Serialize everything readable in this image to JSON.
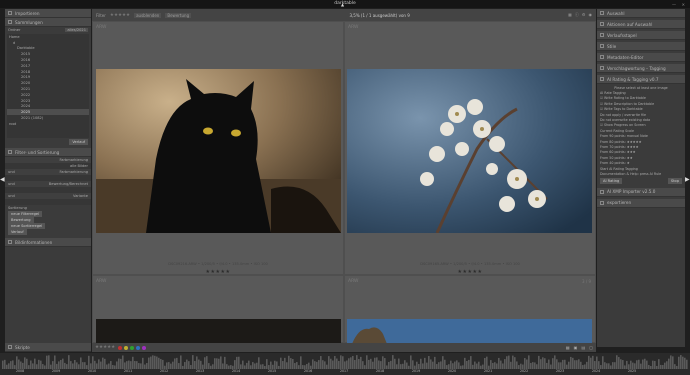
{
  "window": {
    "title": "darktable"
  },
  "left_panel": {
    "modules": {
      "import": "Importieren",
      "collections": "Sammlungen",
      "filters": "Filter- und Sortierung",
      "image_info": "Bildinformationen"
    },
    "collection_rule": {
      "label": "Ordner",
      "value": "alles/2021"
    },
    "tree": [
      "Home",
      "d",
      "Darktable",
      "2015",
      "2016",
      "2017",
      "2018",
      "2019",
      "2020",
      "2021",
      "2022",
      "2023",
      "2024",
      "2025",
      "2021 (1082)",
      "root"
    ],
    "tree_selected_index": 13,
    "history_button": "Verlauf",
    "filter_rows": [
      {
        "label": "",
        "value": "Farbmarkierung"
      },
      {
        "label": "",
        "value": "alle Bilder"
      },
      {
        "label": "und",
        "value": "Farbmarkierung"
      },
      {
        "label": "",
        "value": ""
      },
      {
        "label": "und",
        "value": "Bewertung/Berechnet"
      },
      {
        "label": "",
        "value": ""
      },
      {
        "label": "und",
        "value": "Variante"
      },
      {
        "label": "",
        "value": ""
      }
    ],
    "sort_label": "Sortierung",
    "sort_rows": [
      "neue Filterregel",
      "Bewertung",
      "neue Sortierregel",
      "Verlauf"
    ],
    "sort_value": "Bewertung"
  },
  "top_bar": {
    "filter_label": "Filter",
    "rating_filter": "ausblenden",
    "sort_label": "Bewertung",
    "count_text": "3,5% (1 / 1 ausgewählt) von 9"
  },
  "thumbnails": [
    {
      "ext": "ARW",
      "info": "DSC09216.ARW • 1/200/5 • f/4.0 • 135.0mm • ISO 100",
      "stars": "★★★★★",
      "subject": "black-cat-photo"
    },
    {
      "ext": "ARW",
      "info": "DSC09165.ARW • 1/200/5 • f/4.0 • 135.0mm • ISO 100",
      "stars": "★★★★★",
      "subject": "white-blossoms-photo"
    },
    {
      "ext": "ARW",
      "info": "",
      "stars": "",
      "subject": "dark-photo"
    },
    {
      "ext": "ARW",
      "info": "",
      "stars": "",
      "subject": "sky-tree-photo"
    }
  ],
  "thumb_counter": "3 / 9",
  "right_panel": {
    "modules": [
      "Auswahl",
      "Aktionen auf Auswahl",
      "Verlaufsstapel",
      "Stile",
      "Metadaten-Editor",
      "Verschlagwortung – Tagging"
    ],
    "plugin_title": "AI Rating & Tagging v0.7",
    "plugin_lines": [
      "Please select at least one image",
      "AI Rate Tagging",
      "☑ Write Rating to Darktable",
      "☑ Write Description to Darktable",
      "☑ Write Tags to Darktable",
      "Do not apply / overwrite file",
      "Do not overwrite existing data",
      "☑ Show Progress on Screen",
      "Current Rating Scale",
      "From 90 points: manual Note",
      "From 80 points: ★★★★★",
      "From 70 points: ★★★★",
      "From 60 points: ★★★",
      "From 50 points: ★★",
      "From 40 points: ★",
      "Start AI Rating Tagging",
      "Documentation & Help: press AI Rule"
    ],
    "plugin_stop": "Stop",
    "plugin_run": "AI Rating",
    "footer_modules": [
      "AI XMP Importer v2.5.0",
      "exportieren"
    ]
  },
  "bottom_bar": {
    "labels": [
      "Skripte"
    ],
    "color_labels": [
      "#c03030",
      "#c0b030",
      "#30a030",
      "#3070c0",
      "#a030c0"
    ]
  },
  "timeline": {
    "years": [
      "2008",
      "2009",
      "2010",
      "2011",
      "2012",
      "2013",
      "2014",
      "2015",
      "2016",
      "2017",
      "2018",
      "2019",
      "2020",
      "2021",
      "2022",
      "2023",
      "2024",
      "2025"
    ]
  }
}
